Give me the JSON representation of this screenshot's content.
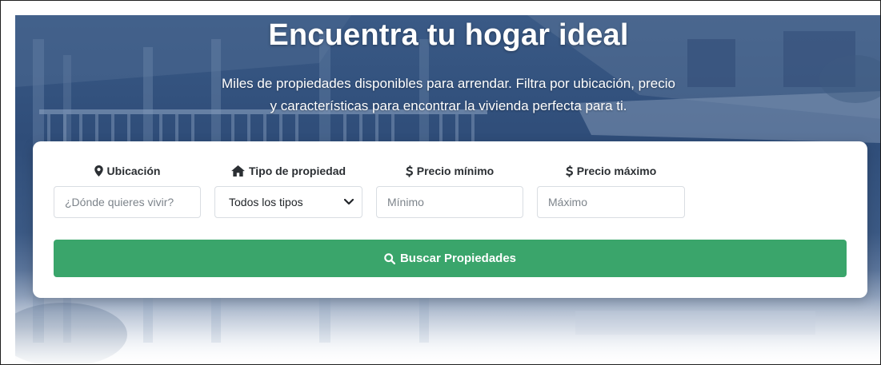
{
  "hero": {
    "title": "Encuentra tu hogar ideal",
    "subtitle_line1": "Miles de propiedades disponibles para arrendar. Filtra por ubicación, precio",
    "subtitle_line2": "y características para encontrar la vivienda perfecta para ti."
  },
  "search": {
    "location": {
      "icon": "map-marker-icon",
      "label": "Ubicación",
      "placeholder": "¿Dónde quieres vivir?",
      "value": ""
    },
    "property_type": {
      "icon": "home-icon",
      "label": "Tipo de propiedad",
      "selected": "Todos los tipos"
    },
    "min_price": {
      "icon": "dollar-icon",
      "label": "Precio mínimo",
      "placeholder": "Mínimo",
      "value": ""
    },
    "max_price": {
      "icon": "dollar-icon",
      "label": "Precio máximo",
      "placeholder": "Máximo",
      "value": ""
    },
    "button": {
      "icon": "search-icon",
      "label": "Buscar Propiedades"
    }
  },
  "colors": {
    "hero_overlay": "#2f4d79",
    "button_green": "#3aa56b",
    "card_bg": "#ffffff",
    "label_text": "#2b2f33"
  }
}
